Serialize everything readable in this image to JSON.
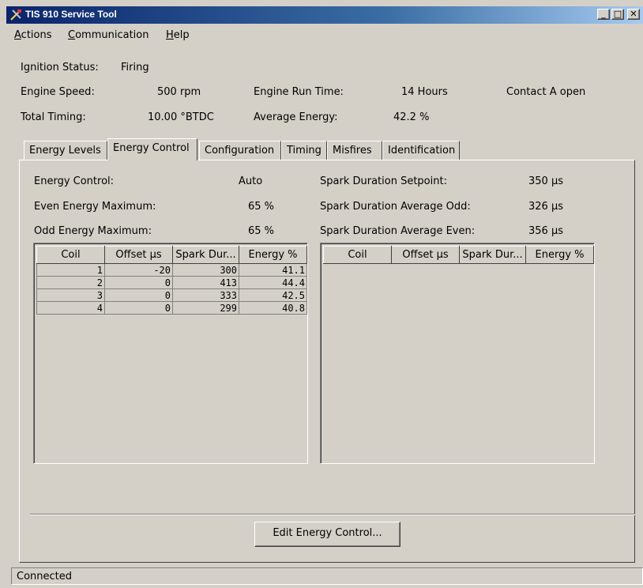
{
  "window": {
    "title": "TIS 910 Service Tool",
    "minimize_glyph": "_",
    "maximize_glyph": "□",
    "close_glyph": "✕"
  },
  "menu": {
    "actions": {
      "first": "A",
      "rest": "ctions"
    },
    "communication": {
      "first": "C",
      "rest": "ommunication"
    },
    "help": {
      "first": "H",
      "rest": "elp"
    }
  },
  "status": {
    "ignition_label": "Ignition Status:",
    "ignition_value": "Firing",
    "speed_label": "Engine Speed:",
    "speed_value": "500 rpm",
    "runtime_label": "Engine Run Time:",
    "runtime_value": "14 Hours",
    "contact": "Contact A open",
    "timing_label": "Total Timing:",
    "timing_value": "10.00 °BTDC",
    "avg_energy_label": "Average Energy:",
    "avg_energy_value": "42.2 %"
  },
  "tabs": [
    "Energy Levels",
    "Energy Control",
    "Configuration",
    "Timing",
    "Misfires",
    "Identification"
  ],
  "active_tab": "Energy Control",
  "energy_control": {
    "mode_label": "Energy Control:",
    "mode_value": "Auto",
    "even_max_label": "Even Energy Maximum:",
    "even_max_value": "65 %",
    "odd_max_label": "Odd Energy Maximum:",
    "odd_max_value": "65 %",
    "setpoint_label": "Spark Duration Setpoint:",
    "setpoint_value": "350 µs",
    "avg_odd_label": "Spark Duration Average Odd:",
    "avg_odd_value": "326 µs",
    "avg_even_label": "Spark Duration Average Even:",
    "avg_even_value": "356 µs"
  },
  "table_headers": [
    "Coil",
    "Offset µs",
    "Spark Dur...",
    "Energy %"
  ],
  "left_table_rows": [
    [
      "1",
      "-20",
      "300",
      "41.1"
    ],
    [
      "2",
      "0",
      "413",
      "44.4"
    ],
    [
      "3",
      "0",
      "333",
      "42.5"
    ],
    [
      "4",
      "0",
      "299",
      "40.8"
    ]
  ],
  "right_table_rows": [],
  "buttons": {
    "edit": "Edit Energy Control..."
  },
  "statusbar": {
    "text": "Connected"
  }
}
